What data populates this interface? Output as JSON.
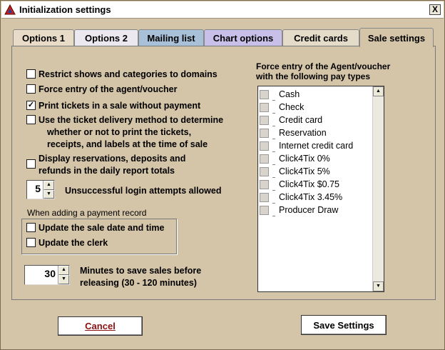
{
  "window": {
    "title": "Initialization settings",
    "close_label": "X"
  },
  "tabs": [
    {
      "label": "Options 1",
      "bg": "#e8dcc8"
    },
    {
      "label": "Options 2",
      "bg": "#ece8f0"
    },
    {
      "label": "Mailing list",
      "bg": "#a8c0d8"
    },
    {
      "label": "Chart options",
      "bg": "#c8c0e8"
    },
    {
      "label": "Credit cards",
      "bg": "#e4dcc8"
    },
    {
      "label": "Sale settings",
      "bg": "#d4c4a8",
      "active": true
    }
  ],
  "options": {
    "restrict_shows": {
      "label": "Restrict shows and categories to domains",
      "checked": false
    },
    "force_agent": {
      "label": "Force entry of the agent/voucher",
      "checked": false
    },
    "print_tickets": {
      "label": "Print tickets in a sale without payment",
      "checked": true,
      "mark": "✓"
    },
    "delivery_method": {
      "label_line1": "Use the ticket delivery method to determine",
      "label_line2": "whether or not to print the tickets,",
      "label_line3": "receipts, and labels at the time of sale",
      "checked": false
    },
    "display_reservations": {
      "label_line1": "Display reservations, deposits and",
      "label_line2": "refunds in the daily report totals",
      "checked": false
    }
  },
  "login_attempts": {
    "value": "5",
    "label": "Unsuccessful login attempts allowed"
  },
  "payment_record": {
    "group_label": "When adding a payment record",
    "update_date": {
      "label": "Update the sale date and time",
      "checked": false
    },
    "update_clerk": {
      "label": "Update the clerk",
      "checked": false
    }
  },
  "minutes_save": {
    "value": "30",
    "label_line1": "Minutes to save sales before",
    "label_line2": "releasing (30 - 120 minutes)"
  },
  "pay_types": {
    "header_line1": "Force entry of the Agent/voucher",
    "header_line2": "with the following pay types",
    "items": [
      "Cash",
      "Check",
      "Credit card",
      "Reservation",
      "Internet credit card",
      "Click4Tix 0%",
      "Click4Tix 5%",
      "Click4Tix $0.75",
      "Click4Tix  3.45%",
      "Producer Draw"
    ]
  },
  "buttons": {
    "cancel": "Cancel",
    "save": "Save Settings"
  }
}
